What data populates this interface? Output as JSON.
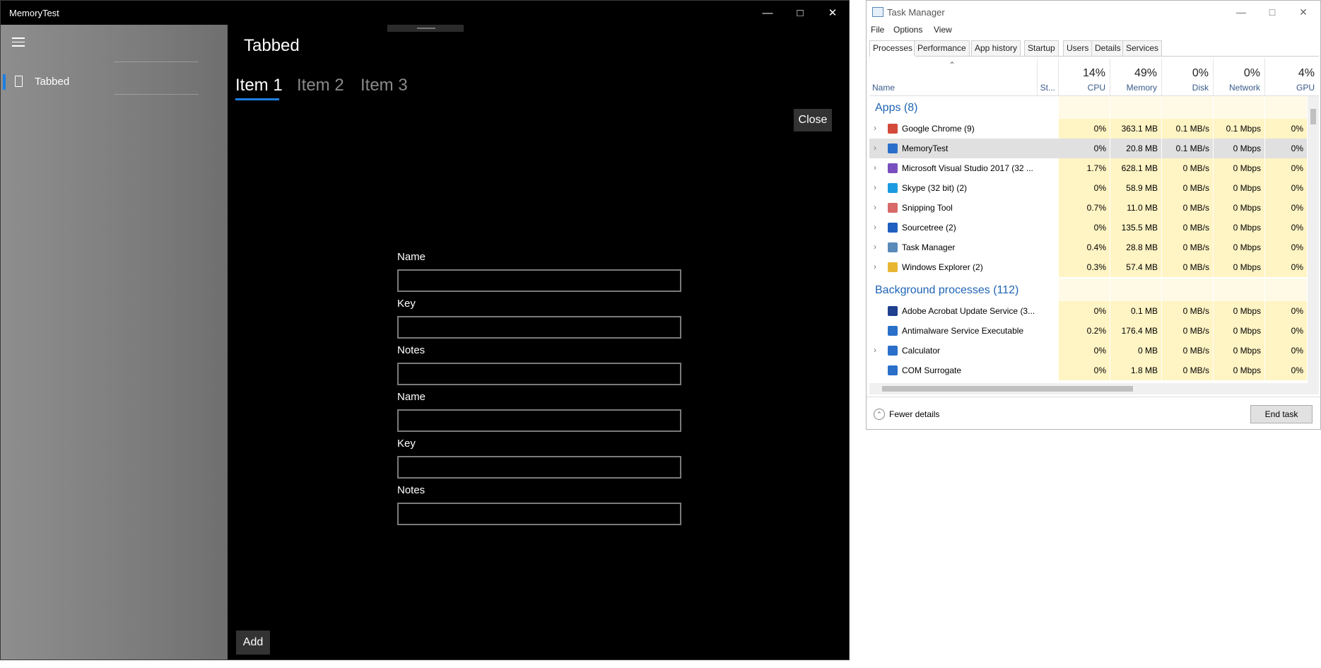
{
  "memorytest": {
    "window_title": "MemoryTest",
    "nav_item": "Tabbed",
    "page_title": "Tabbed",
    "tabs": [
      "Item 1",
      "Item 2",
      "Item 3"
    ],
    "close_label": "Close",
    "add_label": "Add",
    "fields": [
      "Name",
      "Key",
      "Notes",
      "Name",
      "Key",
      "Notes"
    ]
  },
  "taskmanager": {
    "title": "Task Manager",
    "menu": [
      "File",
      "Options",
      "View"
    ],
    "tabs": [
      "Processes",
      "Performance",
      "App history",
      "Startup",
      "Users",
      "Details",
      "Services"
    ],
    "columns": {
      "name": "Name",
      "status": "St...",
      "cpu": {
        "pct": "14%",
        "label": "CPU"
      },
      "memory": {
        "pct": "49%",
        "label": "Memory"
      },
      "disk": {
        "pct": "0%",
        "label": "Disk"
      },
      "network": {
        "pct": "0%",
        "label": "Network"
      },
      "gpu": {
        "pct": "4%",
        "label": "GPU"
      }
    },
    "apps_group": "Apps (8)",
    "apps": [
      {
        "name": "Google Chrome (9)",
        "cpu": "0%",
        "memory": "363.1 MB",
        "disk": "0.1 MB/s",
        "network": "0.1 Mbps",
        "gpu": "0%",
        "icon_color": "#d44a3a"
      },
      {
        "name": "MemoryTest",
        "cpu": "0%",
        "memory": "20.8 MB",
        "disk": "0.1 MB/s",
        "network": "0 Mbps",
        "gpu": "0%",
        "icon_color": "#2a6fc9"
      },
      {
        "name": "Microsoft Visual Studio 2017 (32 ...",
        "cpu": "1.7%",
        "memory": "628.1 MB",
        "disk": "0 MB/s",
        "network": "0 Mbps",
        "gpu": "0%",
        "icon_color": "#7a4fbf"
      },
      {
        "name": "Skype (32 bit) (2)",
        "cpu": "0%",
        "memory": "58.9 MB",
        "disk": "0 MB/s",
        "network": "0 Mbps",
        "gpu": "0%",
        "icon_color": "#1c9be0"
      },
      {
        "name": "Snipping Tool",
        "cpu": "0.7%",
        "memory": "11.0 MB",
        "disk": "0 MB/s",
        "network": "0 Mbps",
        "gpu": "0%",
        "icon_color": "#d86a6a"
      },
      {
        "name": "Sourcetree (2)",
        "cpu": "0%",
        "memory": "135.5 MB",
        "disk": "0 MB/s",
        "network": "0 Mbps",
        "gpu": "0%",
        "icon_color": "#1f5fbf"
      },
      {
        "name": "Task Manager",
        "cpu": "0.4%",
        "memory": "28.8 MB",
        "disk": "0 MB/s",
        "network": "0 Mbps",
        "gpu": "0%",
        "icon_color": "#5a8ab8"
      },
      {
        "name": "Windows Explorer (2)",
        "cpu": "0.3%",
        "memory": "57.4 MB",
        "disk": "0 MB/s",
        "network": "0 Mbps",
        "gpu": "0%",
        "icon_color": "#e8b632"
      }
    ],
    "bg_group": "Background processes (112)",
    "background": [
      {
        "name": "Adobe Acrobat Update Service (3...",
        "cpu": "0%",
        "memory": "0.1 MB",
        "disk": "0 MB/s",
        "network": "0 Mbps",
        "gpu": "0%",
        "icon_color": "#1f3f8f"
      },
      {
        "name": "Antimalware Service Executable",
        "cpu": "0.2%",
        "memory": "176.4 MB",
        "disk": "0 MB/s",
        "network": "0 Mbps",
        "gpu": "0%",
        "icon_color": "#2a6fc9"
      },
      {
        "name": "Calculator",
        "cpu": "0%",
        "memory": "0 MB",
        "disk": "0 MB/s",
        "network": "0 Mbps",
        "gpu": "0%",
        "icon_color": "#2a6fc9"
      },
      {
        "name": "COM Surrogate",
        "cpu": "0%",
        "memory": "1.8 MB",
        "disk": "0 MB/s",
        "network": "0 Mbps",
        "gpu": "0%",
        "icon_color": "#2a6fc9"
      }
    ],
    "fewer_details": "Fewer details",
    "end_task": "End task"
  }
}
